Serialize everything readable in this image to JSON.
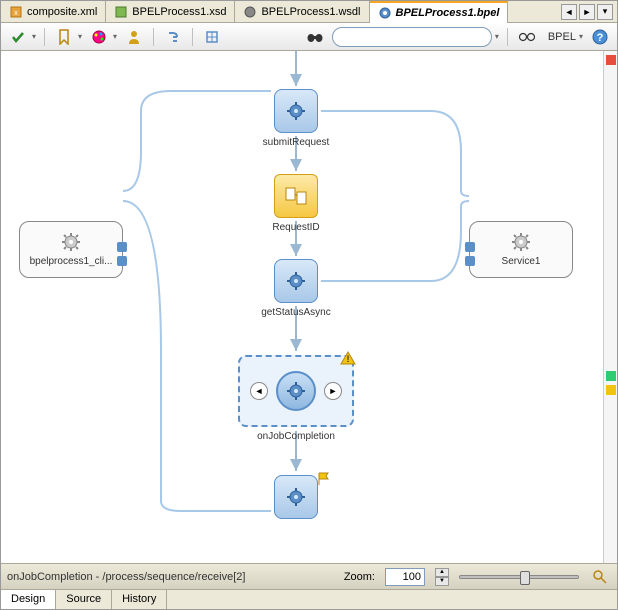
{
  "tabs": [
    {
      "label": "composite.xml",
      "icon": "xml"
    },
    {
      "label": "BPELProcess1.xsd",
      "icon": "xsd"
    },
    {
      "label": "BPELProcess1.wsdl",
      "icon": "wsdl"
    },
    {
      "label": "BPELProcess1.bpel",
      "icon": "bpel",
      "active": true
    }
  ],
  "toolbar": {
    "search_placeholder": "",
    "bpel_label": "BPEL"
  },
  "partners": {
    "left_label": "bpelprocess1_cli...",
    "right_label": "Service1"
  },
  "activities": {
    "submitRequest": "submitRequest",
    "requestId": "RequestID",
    "getStatusAsync": "getStatusAsync",
    "onJobCompletion": "onJobCompletion"
  },
  "status": {
    "path": "onJobCompletion - /process/sequence/receive[2]",
    "zoom_label": "Zoom:",
    "zoom_value": "100"
  },
  "bottom_tabs": [
    "Design",
    "Source",
    "History"
  ],
  "colors": {
    "activity_bg": "#c8dff5",
    "assign_bg": "#f5c842",
    "selection": "#5a8fc8"
  }
}
